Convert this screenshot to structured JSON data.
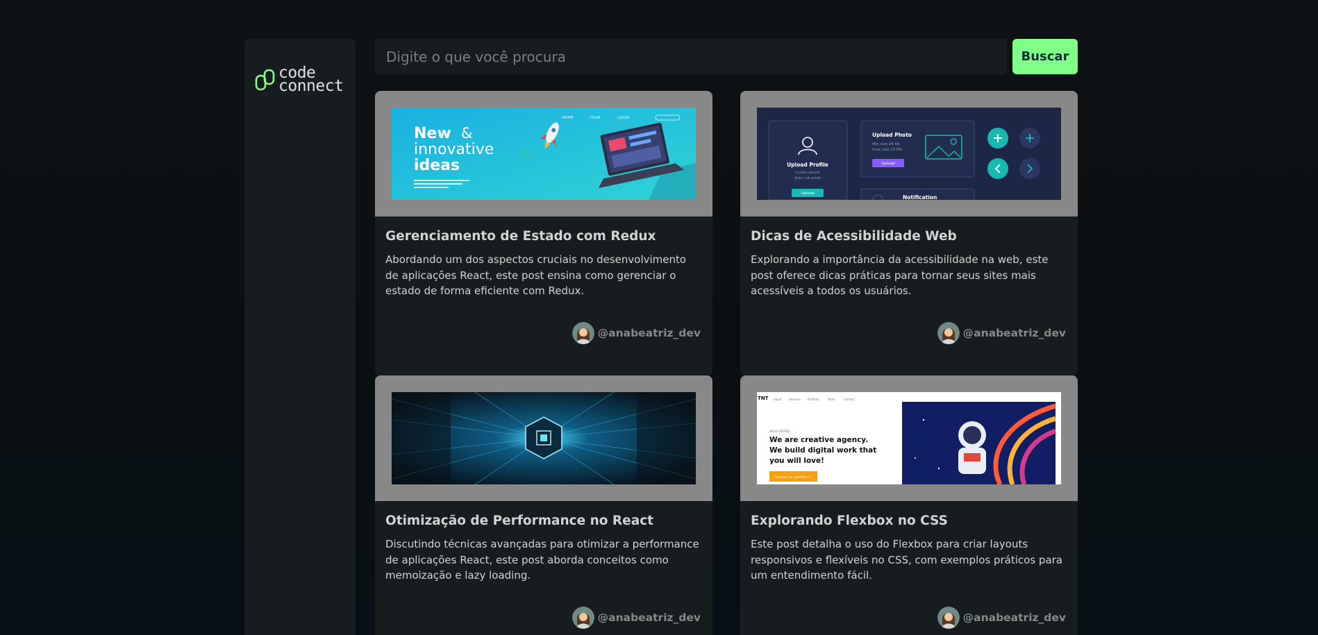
{
  "logo": {
    "line1": "code",
    "line2": "connect"
  },
  "search": {
    "placeholder": "Digite o que você procura",
    "value": "",
    "button_label": "Buscar"
  },
  "colors": {
    "accent": "#81fe88",
    "card_bg": "#171d1f",
    "image_bg": "#888888"
  },
  "posts": [
    {
      "title": "Gerenciamento de Estado com Redux",
      "description": "Abordando um dos aspectos cruciais no desenvolvimento de aplicações React, este post ensina como gerenciar o estado de forma eficiente com Redux.",
      "author": "@anabeatriz_dev",
      "image": {
        "nav": [
          "HOME",
          "TOUR",
          "LOGIN"
        ],
        "headline_line1": "New",
        "headline_amp": "&",
        "headline_line2": "innovative",
        "headline_line3": "ideas"
      }
    },
    {
      "title": "Dicas de Acessibilidade Web",
      "description": "Explorando a importância da acessibilidade na web, este post oferece dicas práticas para tornar seus sites mais acessíveis a todos os usuários.",
      "author": "@anabeatriz_dev",
      "image": {
        "profile_title": "Upload Profile",
        "profile_text1": "Lorem ipsum",
        "profile_text2": "dolor sit amet",
        "profile_button": "Upload",
        "photo_title": "Upload Photo",
        "photo_text1": "Min size 24 Kb",
        "photo_text2": "max size 15 Mb",
        "photo_button": "Upload",
        "notification_title": "Notification"
      }
    },
    {
      "title": "Otimização de Performance no React",
      "description": "Discutindo técnicas avançadas para otimizar a performance de aplicações React, este post aborda conceitos como memoização e lazy loading.",
      "author": "@anabeatriz_dev",
      "image": {}
    },
    {
      "title": "Explorando Flexbox no CSS",
      "description": "Este post detalha o uso do Flexbox para criar layouts responsivos e flexíveis no CSS, com exemplos práticos para um entendimento fácil.",
      "author": "@anabeatriz_dev",
      "image": {
        "brand": "TNT",
        "nav": [
          "About",
          "Services",
          "Portfolio",
          "Team",
          "Contact"
        ],
        "kicker": "HELLO PEOPLE",
        "headline_line1": "We are creative agency.",
        "headline_line2": "We build digital work that",
        "headline_line3": "you will love!",
        "cta": "Explore our portfolio →"
      }
    }
  ]
}
